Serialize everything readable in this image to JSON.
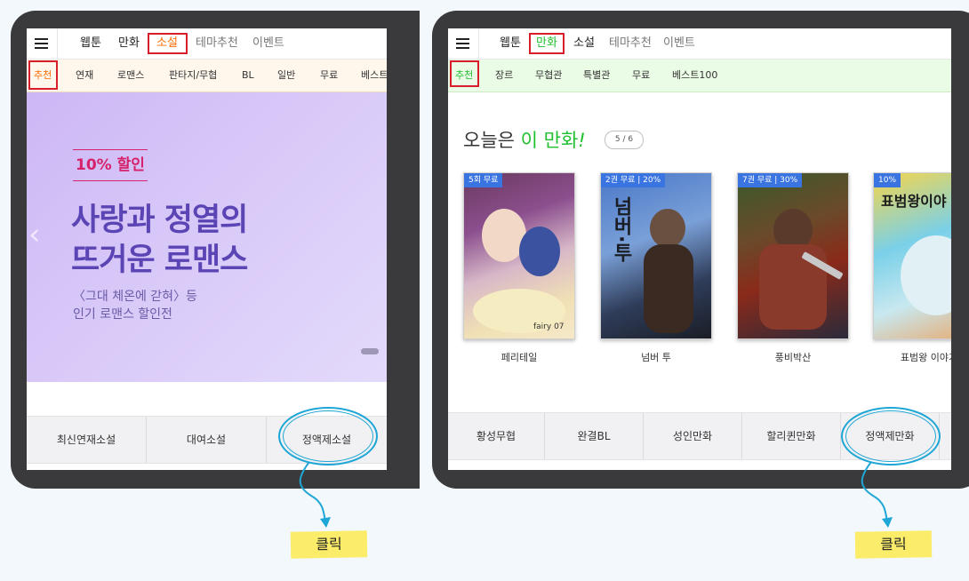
{
  "left": {
    "topnav": [
      "웹툰",
      "만화",
      "소설",
      "테마추천",
      "이벤트"
    ],
    "subnav": [
      "추천",
      "연재",
      "로맨스",
      "판타지/무협",
      "BL",
      "일반",
      "무료",
      "베스트"
    ],
    "banner": {
      "badge": "10% 할인",
      "headline1": "사랑과 정열의",
      "headline2": "뜨거운 로맨스",
      "sub1": "〈그대 체온에 갇혀〉등",
      "sub2": "인기 로맨스 할인전",
      "arrow": "‹"
    },
    "categories": [
      "최신연재소설",
      "대여소설",
      "정액제소설"
    ],
    "click_label": "클릭"
  },
  "right": {
    "topnav": [
      "웹툰",
      "만화",
      "소설",
      "테마추천",
      "이벤트"
    ],
    "subnav": [
      "추천",
      "장르",
      "무협관",
      "특별관",
      "무료",
      "베스트100"
    ],
    "today": {
      "prefix": "오늘은",
      "highlight": "이 만화",
      "suffix": "!",
      "pager": "5 / 6"
    },
    "books": [
      {
        "badge": "5회 무료",
        "title": "페리테일",
        "cover_text": "fairy 07"
      },
      {
        "badge": "2권 무료 | 20%",
        "title": "넘버 투",
        "cover_text": "넘버·투"
      },
      {
        "badge": "7권 무료 | 30%",
        "title": "풍비박산",
        "cover_text": ""
      },
      {
        "badge": "10%",
        "title": "표범왕 이야기",
        "cover_text": "표범왕이야"
      }
    ],
    "categories": [
      "황성무협",
      "완결BL",
      "성인만화",
      "할리퀸만화",
      "정액제만화"
    ],
    "click_label": "클릭"
  },
  "colors": {
    "novel_accent": "#ff6a00",
    "comic_accent": "#1fbf2e",
    "highlight_box": "#d81e2a",
    "annotation": "#1ea6d6",
    "banner_text": "#5b45b5",
    "badge_blue": "#3a74e0"
  }
}
